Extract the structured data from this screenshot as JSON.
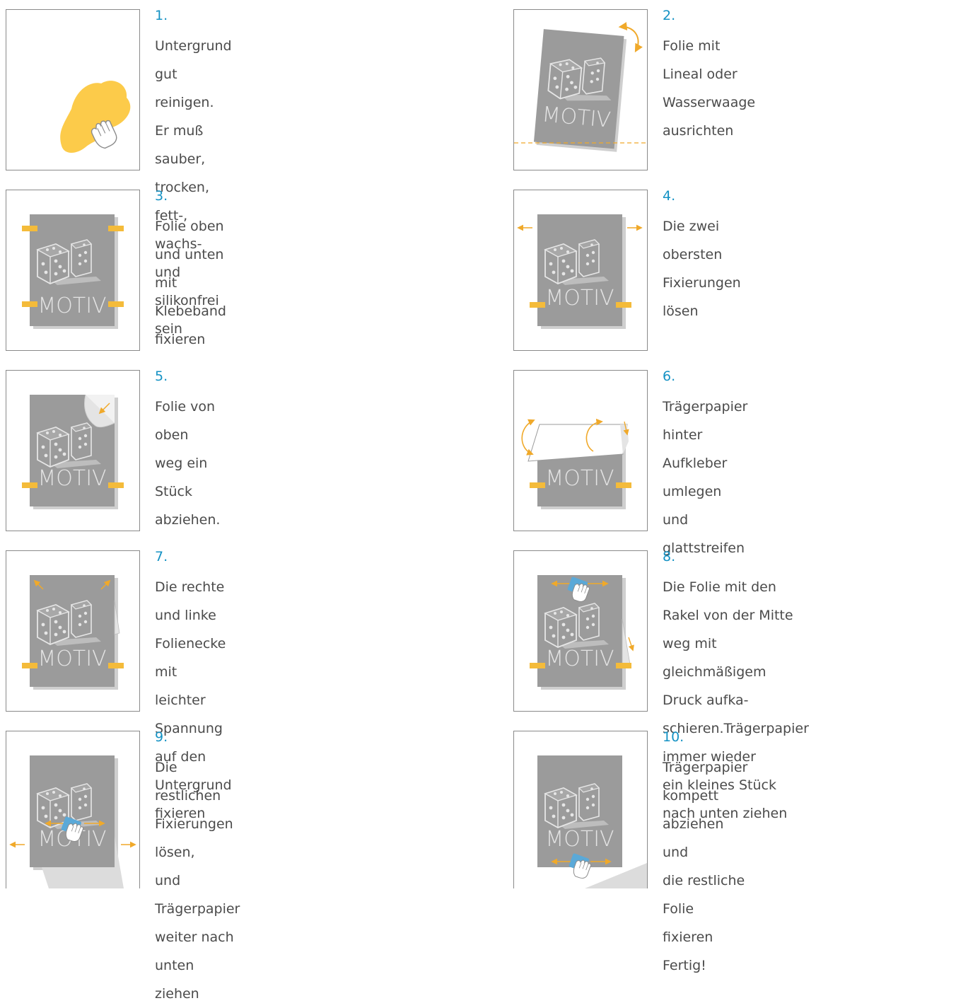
{
  "colors": {
    "accent_number": "#1592c4",
    "sticker": "#9b9b9b",
    "tape": "#f4bb3a",
    "arrow": "#f0a92a",
    "squeegee": "#5aa9d8",
    "stain": "#fccb4a"
  },
  "motif_label": "MOTIV",
  "steps": [
    {
      "num": "1.",
      "text": "Untergrund gut reinigen. Er muß\nsauber, trocken, fett-, wachs- und\nsilikonfrei sein"
    },
    {
      "num": "2.",
      "text": "Folie mit Lineal oder Wasserwaage\nausrichten"
    },
    {
      "num": "3.",
      "text": "Folie oben und unten mit Klebeband\nfixieren"
    },
    {
      "num": "4.",
      "text": "Die zwei obersten Fixierungen lösen"
    },
    {
      "num": "5.",
      "text": "Folie von oben weg ein Stück abziehen."
    },
    {
      "num": "6.",
      "text": "Trägerpapier hinter Aufkleber umlegen\nund glattstreifen"
    },
    {
      "num": "7.",
      "text": "Die rechte und linke Folienecke mit\nleichter Spannung auf den Untergrund\nfixieren"
    },
    {
      "num": "8.",
      "text": "Die Folie mit den Rakel von der Mitte\nweg mit gleichmäßigem Druck aufka-\nschieren.Trägerpapier immer wieder\nein kleines Stück nach unten ziehen"
    },
    {
      "num": "9.",
      "text": "Die restlichen Fixierungen lösen,\nund Trägerpapier weiter nach unten\nziehen"
    },
    {
      "num": "10.",
      "text": "Trägerpapier kompett abziehen und\ndie restliche Folie fixieren\nFertig!"
    }
  ]
}
